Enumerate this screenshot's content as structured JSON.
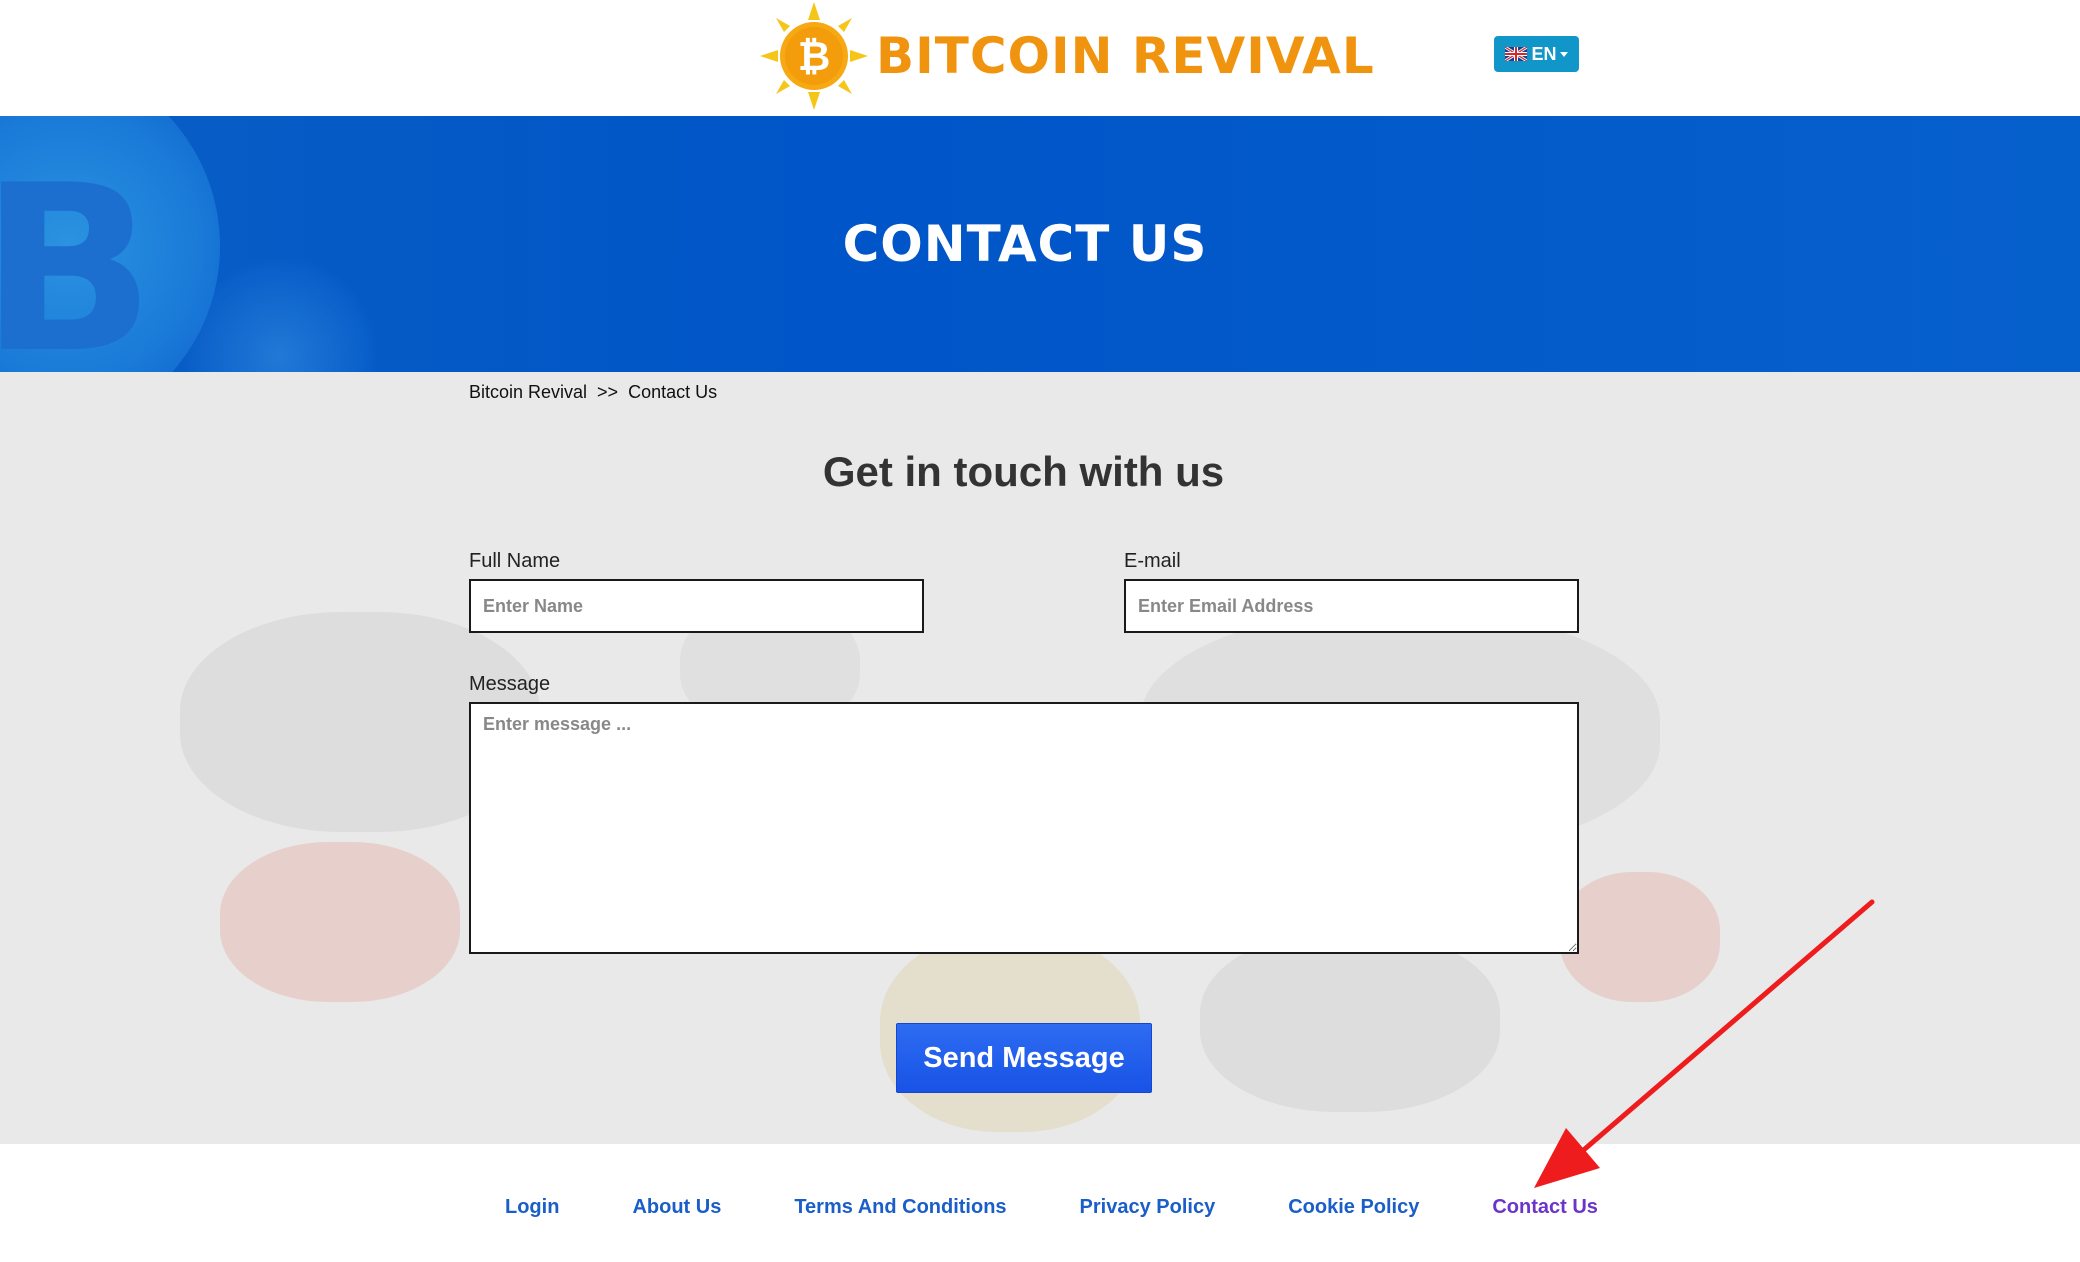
{
  "brand": {
    "name": "BITCOIN REVIVAL",
    "logo_icon": "bitcoin-sun-logo",
    "accent_color": "#f0940f"
  },
  "language": {
    "selected": "EN",
    "flag_icon": "uk-flag-icon"
  },
  "hero": {
    "title": "CONTACT US"
  },
  "breadcrumb": {
    "home": "Bitcoin Revival",
    "separator": ">>",
    "current": "Contact Us"
  },
  "form": {
    "heading": "Get in touch with us",
    "name_label": "Full Name",
    "name_placeholder": "Enter Name",
    "email_label": "E-mail",
    "email_placeholder": "Enter Email Address",
    "message_label": "Message",
    "message_placeholder": "Enter message ...",
    "submit_label": "Send Message"
  },
  "footer": {
    "links": [
      "Login",
      "About Us",
      "Terms And Conditions",
      "Privacy Policy",
      "Cookie Policy",
      "Contact Us"
    ]
  },
  "colors": {
    "hero_blue": "#0055c8",
    "button_blue": "#1853e6",
    "link_blue": "#1a5ec8",
    "visited_link": "#6a35c8",
    "annotation_red": "#ee1c1c"
  }
}
